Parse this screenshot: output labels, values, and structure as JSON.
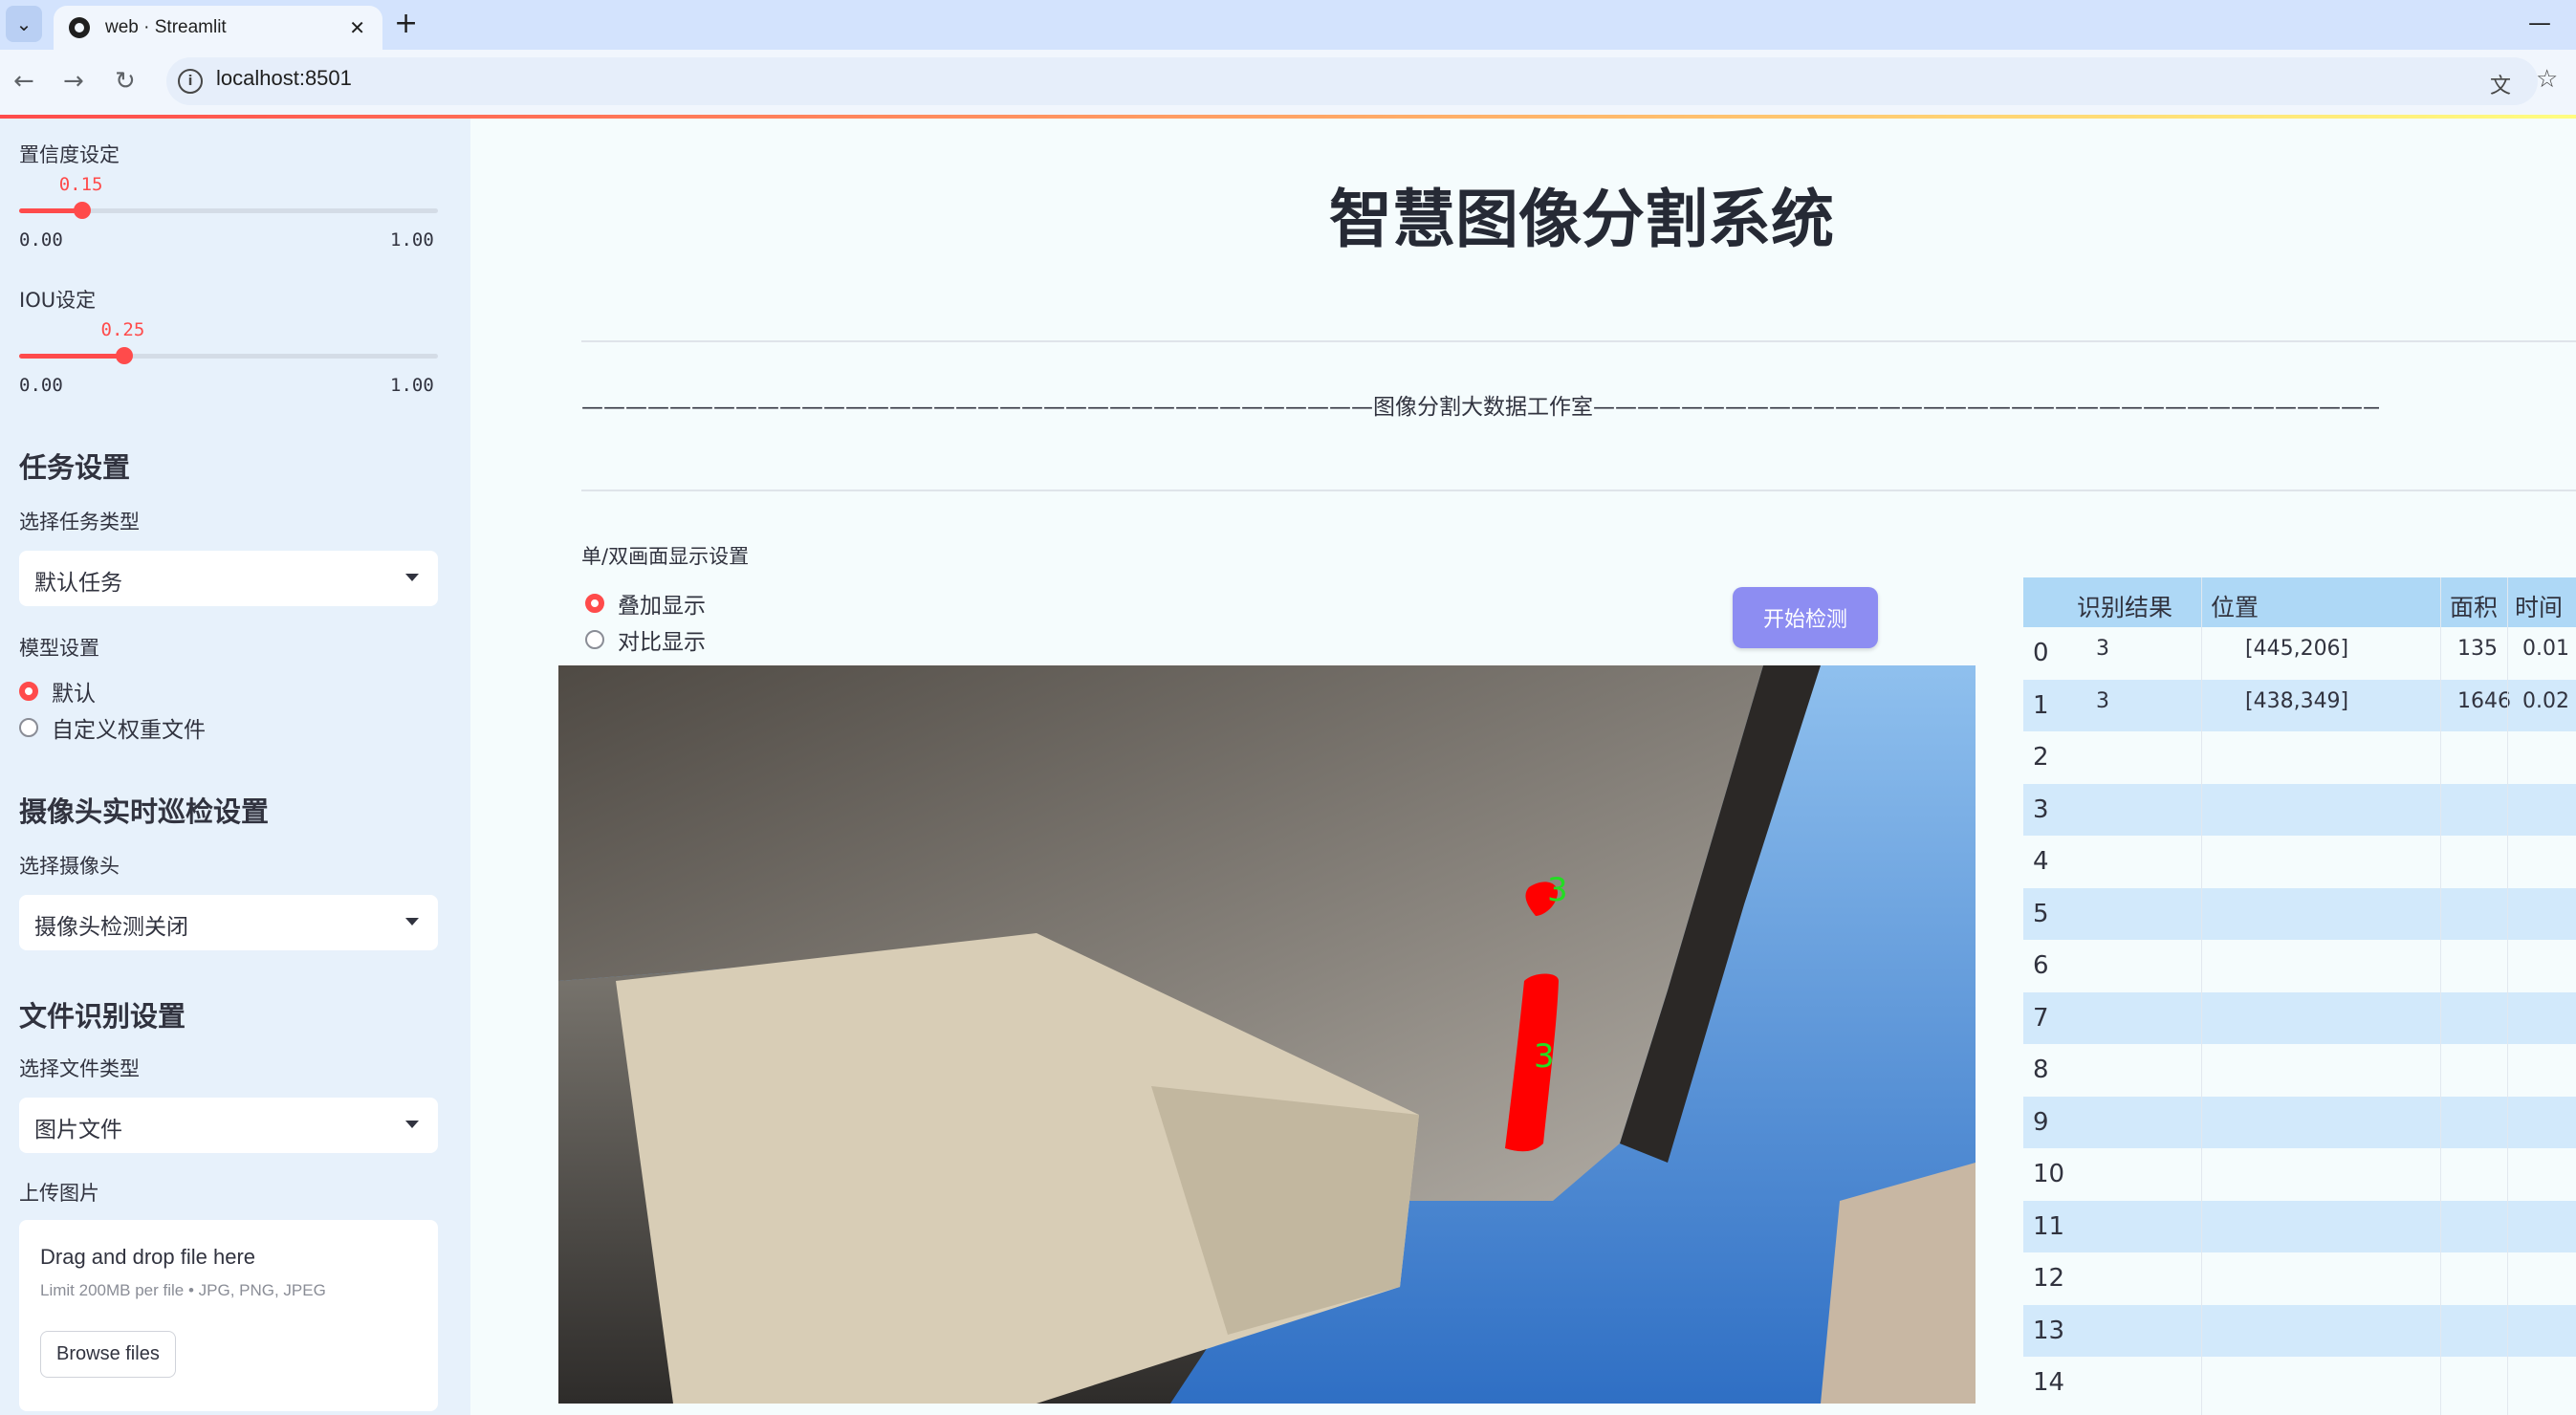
{
  "browser": {
    "tab_title": "web · Streamlit",
    "url": "localhost:8501"
  },
  "sidebar": {
    "confidence": {
      "label": "置信度设定",
      "value": 0.15,
      "value_text": "0.15",
      "min_text": "0.00",
      "max_text": "1.00"
    },
    "iou": {
      "label": "IOU设定",
      "value": 0.25,
      "value_text": "0.25",
      "min_text": "0.00",
      "max_text": "1.00"
    },
    "task_heading": "任务设置",
    "task_type_label": "选择任务类型",
    "task_type_value": "默认任务",
    "model_label": "模型设置",
    "model_options": [
      "默认",
      "自定义权重文件"
    ],
    "model_selected": 0,
    "camera_heading": "摄像头实时巡检设置",
    "camera_label": "选择摄像头",
    "camera_value": "摄像头检测关闭",
    "file_heading": "文件识别设置",
    "file_type_label": "选择文件类型",
    "file_type_value": "图片文件",
    "upload_label": "上传图片",
    "upload_title": "Drag and drop file here",
    "upload_limit": "Limit 200MB per file • JPG, PNG, JPEG",
    "browse_button": "Browse files"
  },
  "main": {
    "title": "智慧图像分割系统",
    "banner": "————————————————————————————————————图像分割大数据工作室————————————————————————————————————",
    "display_label": "单/双画面显示设置",
    "display_options": [
      "叠加显示",
      "对比显示"
    ],
    "display_selected": 0,
    "start_button": "开始检测",
    "detections": [
      {
        "label": "3"
      },
      {
        "label": "3"
      }
    ]
  },
  "table": {
    "columns": [
      "识别结果",
      "位置",
      "面积",
      "时间"
    ],
    "rows": [
      {
        "index": "0",
        "result": "3",
        "position": "[445,206]",
        "area": "135",
        "time": "0.01"
      },
      {
        "index": "1",
        "result": "3",
        "position": "[438,349]",
        "area": "1646",
        "time": "0.02"
      },
      {
        "index": "2",
        "result": "",
        "position": "",
        "area": "",
        "time": ""
      },
      {
        "index": "3",
        "result": "",
        "position": "",
        "area": "",
        "time": ""
      },
      {
        "index": "4",
        "result": "",
        "position": "",
        "area": "",
        "time": ""
      },
      {
        "index": "5",
        "result": "",
        "position": "",
        "area": "",
        "time": ""
      },
      {
        "index": "6",
        "result": "",
        "position": "",
        "area": "",
        "time": ""
      },
      {
        "index": "7",
        "result": "",
        "position": "",
        "area": "",
        "time": ""
      },
      {
        "index": "8",
        "result": "",
        "position": "",
        "area": "",
        "time": ""
      },
      {
        "index": "9",
        "result": "",
        "position": "",
        "area": "",
        "time": ""
      },
      {
        "index": "10",
        "result": "",
        "position": "",
        "area": "",
        "time": ""
      },
      {
        "index": "11",
        "result": "",
        "position": "",
        "area": "",
        "time": ""
      },
      {
        "index": "12",
        "result": "",
        "position": "",
        "area": "",
        "time": ""
      },
      {
        "index": "13",
        "result": "",
        "position": "",
        "area": "",
        "time": ""
      },
      {
        "index": "14",
        "result": "",
        "position": "",
        "area": "",
        "time": ""
      }
    ]
  },
  "colors": {
    "accent": "#ff4b4b",
    "sidebar_bg": "#e7f1fb",
    "button_bg": "#8d8df2",
    "table_header": "#aed8f6",
    "table_alt_row": "#d2e9fb",
    "detection_mask": "#ff0000",
    "detection_label": "#22dd22"
  },
  "icons": [
    "tab-list-icon",
    "streamlit-favicon-icon",
    "close-icon",
    "plus-icon",
    "minimize-icon",
    "back-icon",
    "forward-icon",
    "reload-icon",
    "site-info-icon",
    "translate-icon",
    "star-icon",
    "chevron-down-icon"
  ]
}
